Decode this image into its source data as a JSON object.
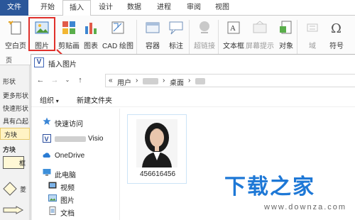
{
  "ribbon_tabs": [
    "文件",
    "开始",
    "插入",
    "设计",
    "数据",
    "进程",
    "审阅",
    "视图"
  ],
  "ribbon_buttons": [
    {
      "label": "空白页",
      "icon": "blank-page-icon",
      "disabled": false
    },
    {
      "label": "图片",
      "icon": "picture-icon",
      "disabled": false
    },
    {
      "label": "剪贴画",
      "icon": "clip-art-icon",
      "disabled": false
    },
    {
      "label": "图表",
      "icon": "chart-icon",
      "disabled": false
    },
    {
      "label": "CAD 绘图",
      "icon": "cad-drawing-icon",
      "disabled": false
    },
    {
      "label": "容器",
      "icon": "container-icon",
      "disabled": false
    },
    {
      "label": "标注",
      "icon": "callout-icon",
      "disabled": false
    },
    {
      "label": "超链接",
      "icon": "hyperlink-icon",
      "disabled": true
    },
    {
      "label": "文本框",
      "icon": "text-box-icon",
      "disabled": false
    },
    {
      "label": "屏幕提示",
      "icon": "screen-tip-icon",
      "disabled": true
    },
    {
      "label": "对象",
      "icon": "object-icon",
      "disabled": false
    },
    {
      "label": "域",
      "icon": "field-icon",
      "disabled": true
    },
    {
      "label": "符号",
      "icon": "symbol-icon",
      "disabled": false
    }
  ],
  "ribbon_group_label": "页",
  "left_panel": {
    "items": [
      "形状",
      "更多形状",
      "快速形状",
      "具有凸起"
    ],
    "selected_band": "方块",
    "section_title": "方块",
    "shape_labels": [
      "框",
      "菱"
    ]
  },
  "dialog": {
    "title": "插入图片",
    "title_icon_letter": "V",
    "address_segments": [
      "用户",
      "桌面"
    ],
    "organize_label": "组织",
    "new_folder_label": "新建文件夹",
    "nav_items": [
      {
        "label": "快速访问",
        "icon": "star-icon"
      },
      {
        "label": "Visio",
        "icon": "visio-icon"
      },
      {
        "label": "OneDrive",
        "icon": "cloud-icon"
      },
      {
        "label": "此电脑",
        "icon": "computer-icon"
      },
      {
        "label": "视频",
        "icon": "video-folder-icon"
      },
      {
        "label": "图片",
        "icon": "pictures-folder-icon"
      },
      {
        "label": "文档",
        "icon": "documents-folder-icon"
      }
    ],
    "file": {
      "name": "456616456"
    }
  },
  "watermark": {
    "text": "下载之家",
    "url": "www.downza.com"
  },
  "colors": {
    "file_tab": "#2b579a",
    "highlight": "#e0302b",
    "watermark": "#1e78d6"
  }
}
